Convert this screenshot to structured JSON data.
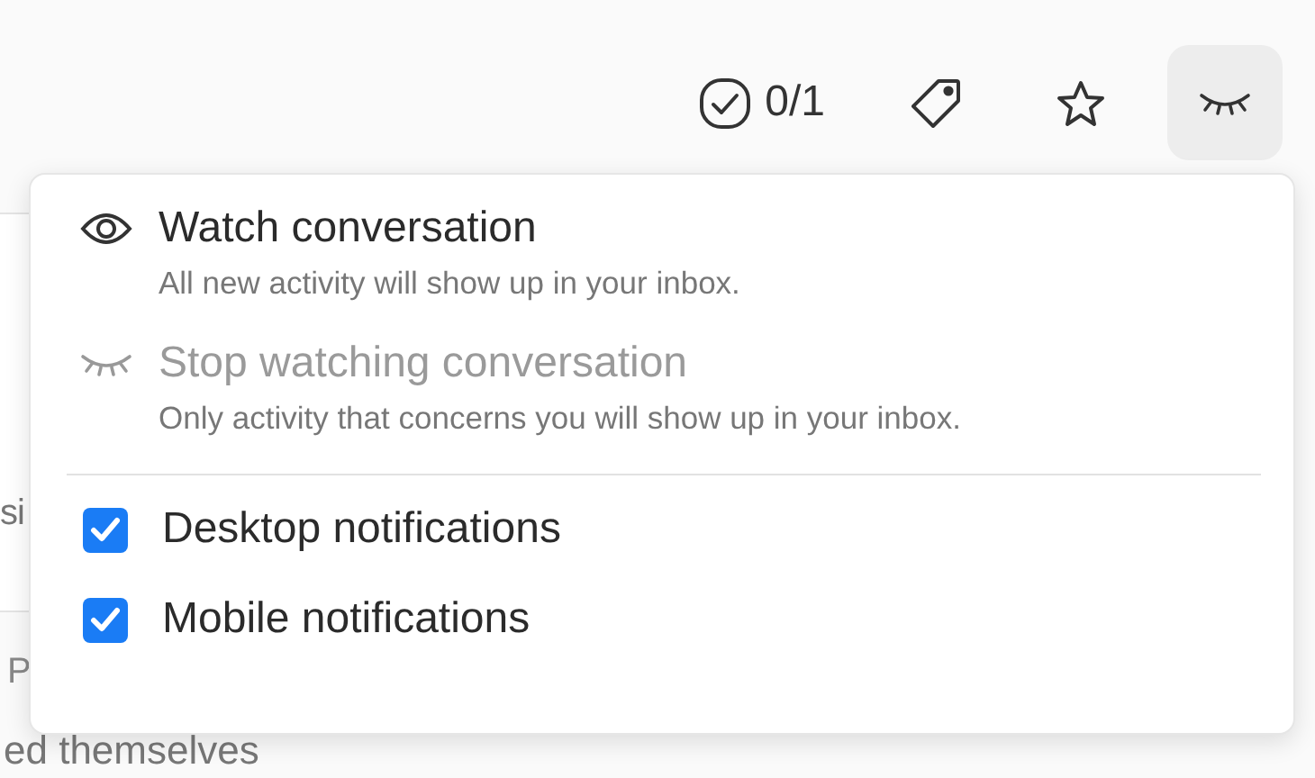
{
  "toolbar": {
    "tasks_count": "0/1"
  },
  "background": {
    "fragments": [
      "si",
      "P",
      "ed themselves"
    ]
  },
  "watch_menu": {
    "items": [
      {
        "title": "Watch conversation",
        "description": "All new activity will show up in your inbox.",
        "kind": "watch",
        "disabled": false
      },
      {
        "title": "Stop watching conversation",
        "description": "Only activity that concerns you will show up in your inbox.",
        "kind": "unwatch",
        "disabled": true
      }
    ],
    "options": [
      {
        "label": "Desktop notifications",
        "checked": true
      },
      {
        "label": "Mobile notifications",
        "checked": true
      }
    ]
  }
}
